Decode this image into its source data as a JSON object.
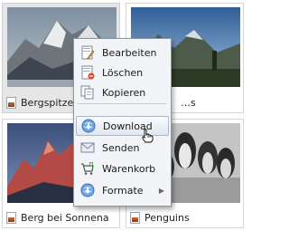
{
  "gallery": {
    "items": [
      {
        "caption": "Bergspitze",
        "selected": true
      },
      {
        "caption": "…s",
        "selected": false
      },
      {
        "caption": "Berg bei Sonnena",
        "selected": false
      },
      {
        "caption": "Penguins",
        "selected": false
      }
    ]
  },
  "context_menu": {
    "items": [
      {
        "label": "Bearbeiten",
        "icon": "edit-document-icon"
      },
      {
        "label": "Löschen",
        "icon": "delete-document-icon"
      },
      {
        "label": "Kopieren",
        "icon": "copy-document-icon"
      },
      {
        "label": "Download",
        "icon": "download-globe-icon",
        "highlighted": true
      },
      {
        "label": "Senden",
        "icon": "envelope-icon"
      },
      {
        "label": "Warenkorb",
        "icon": "shopping-cart-icon"
      },
      {
        "label": "Formate",
        "icon": "formats-globe-icon",
        "has_submenu": true
      }
    ]
  },
  "colors": {
    "menu_bg": "#f2f4f7",
    "menu_border": "#8c96a3",
    "tile_selected": "#e6e6e6"
  }
}
